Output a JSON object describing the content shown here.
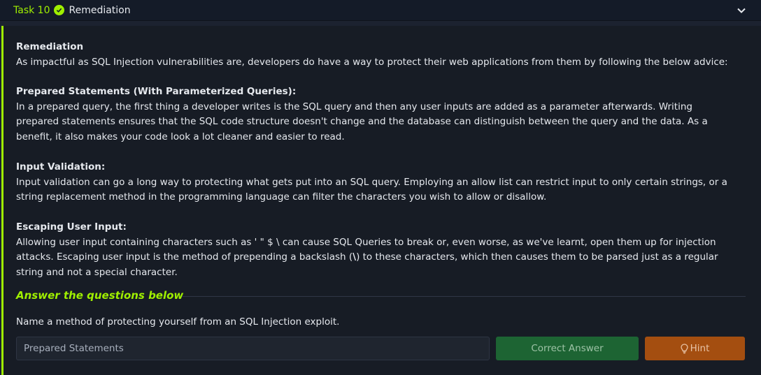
{
  "header": {
    "task_number": "Task 10",
    "title": "Remediation"
  },
  "sections": {
    "intro_title": "Remediation",
    "intro_text": "As impactful as SQL Injection vulnerabilities are, developers do have a way to protect their web applications from them by following the below advice:",
    "prepared_title": "Prepared Statements (With Parameterized Queries):",
    "prepared_text": "In a prepared query, the first thing a developer writes is the SQL query and then any user inputs are added as a parameter afterwards. Writing prepared statements ensures that the SQL code structure doesn't change and the database can distinguish between the query and the data. As a benefit, it also makes your code look a lot cleaner and easier to read.",
    "validation_title": "Input Validation:",
    "validation_text": "Input validation can go a long way to protecting what gets put into an SQL query. Employing an allow list can restrict input to only certain strings, or a string replacement method in the programming language can filter the characters you wish to allow or disallow.",
    "escaping_title": "Escaping User Input:",
    "escaping_text_1": "Allowing user input containing characters such as ' \" $ \\ can cause SQL Queries to break or, even worse, as we've learnt, open them up for injection attacks. Escaping user input is the method of prepending a backslash (",
    "escaping_backslash": "\\",
    "escaping_text_2": ") to these characters, which then causes them to be parsed just as a regular string and not a special character."
  },
  "questions": {
    "heading": "Answer the questions below",
    "q1": {
      "text": "Name a method of protecting yourself from an SQL Injection exploit.",
      "answer_value": "Prepared Statements",
      "submit_label": "Correct Answer",
      "hint_label": "Hint"
    }
  },
  "colors": {
    "accent": "#9fef00",
    "correct": "#1d6433",
    "hint": "#a44e10"
  }
}
